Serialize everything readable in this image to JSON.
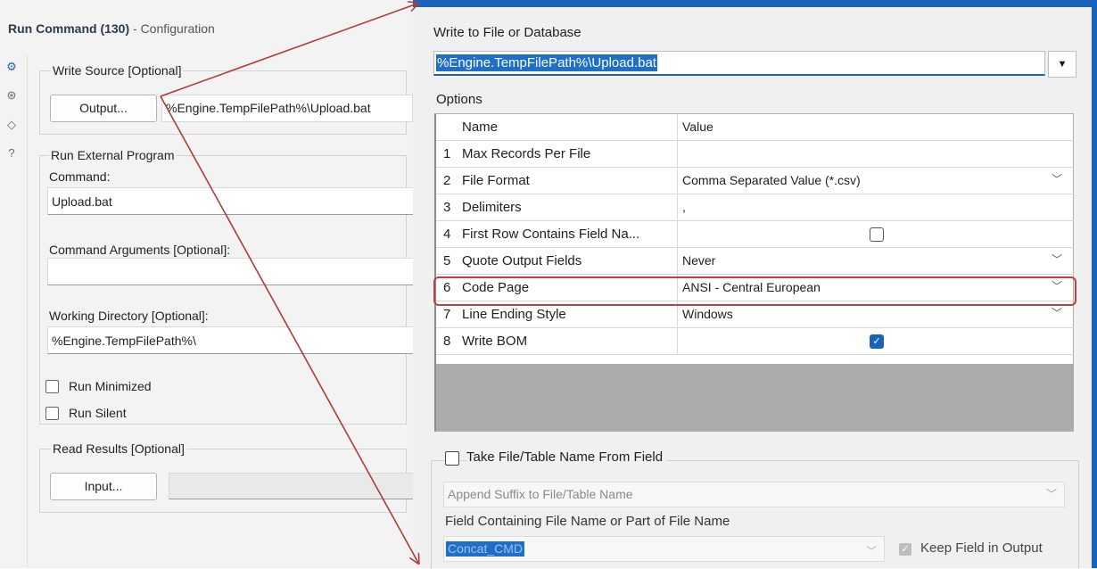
{
  "left": {
    "title_bold": "Run Command (130)",
    "title_sub": " - Configuration",
    "side_icons": [
      "gear-icon",
      "arrows-icon",
      "tag-icon",
      "help-icon"
    ],
    "write_source": {
      "legend": "Write Source [Optional]",
      "button": "Output...",
      "path": "%Engine.TempFilePath%\\Upload.bat"
    },
    "run_external": {
      "legend": "Run External Program",
      "command_label": "Command:",
      "command_value": "Upload.bat",
      "args_label": "Command Arguments [Optional]:",
      "args_value": "",
      "workdir_label": "Working Directory [Optional]:",
      "workdir_value": "%Engine.TempFilePath%\\"
    },
    "run_minimized": "Run Minimized",
    "run_silent": "Run Silent",
    "read_results": {
      "legend": "Read Results [Optional]",
      "button": "Input..."
    }
  },
  "right": {
    "title": "Write to File or Database",
    "file_value": "%Engine.TempFilePath%\\Upload.bat",
    "options_label": "Options",
    "header": {
      "name": "Name",
      "value": "Value"
    },
    "rows": [
      {
        "num": "1",
        "name": "Max Records Per File",
        "value": "",
        "kind": "text"
      },
      {
        "num": "2",
        "name": "File Format",
        "value": "Comma Separated Value (*.csv)",
        "kind": "dropdown"
      },
      {
        "num": "3",
        "name": "Delimiters",
        "value": ",",
        "kind": "text"
      },
      {
        "num": "4",
        "name": "First Row Contains Field Na...",
        "value": "",
        "kind": "checkbox",
        "checked": false
      },
      {
        "num": "5",
        "name": "Quote Output Fields",
        "value": "Never",
        "kind": "dropdown"
      },
      {
        "num": "6",
        "name": "Code Page",
        "value": "ANSI - Central European",
        "kind": "dropdown"
      },
      {
        "num": "7",
        "name": "Line Ending Style",
        "value": "Windows",
        "kind": "dropdown"
      },
      {
        "num": "8",
        "name": "Write BOM",
        "value": "",
        "kind": "checkbox",
        "checked": true
      }
    ],
    "take_file_label": "Take File/Table Name From Field",
    "suffix_value": "Append Suffix to File/Table Name",
    "field_label": "Field Containing File Name or Part of File Name",
    "field_value": "Concat_CMD",
    "keep_field_label": "Keep Field in Output",
    "colors": {
      "accent": "#1a63ba",
      "highlight": "#b94141",
      "arrow": "#b03a3a"
    }
  }
}
